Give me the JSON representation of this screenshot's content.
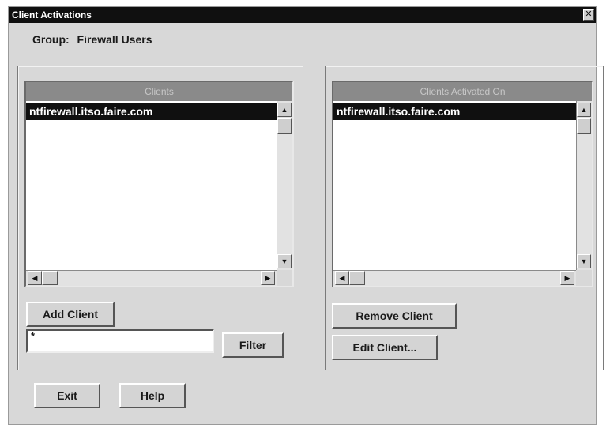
{
  "window": {
    "title": "Client Activations",
    "close_glyph": "✕"
  },
  "group": {
    "label": "Group:",
    "value": "Firewall Users"
  },
  "clients_panel": {
    "header": "Clients",
    "items": [
      "ntfirewall.itso.faire.com"
    ],
    "add_button": "Add Client",
    "filter_value": "*",
    "filter_button": "Filter"
  },
  "activated_panel": {
    "header": "Clients Activated On",
    "items": [
      "ntfirewall.itso.faire.com"
    ],
    "remove_button": "Remove Client",
    "edit_button": "Edit Client..."
  },
  "footer": {
    "exit_button": "Exit",
    "help_button": "Help"
  },
  "icons": {
    "up_arrow": "▲",
    "down_arrow": "▼",
    "left_arrow": "◀",
    "right_arrow": "▶"
  }
}
